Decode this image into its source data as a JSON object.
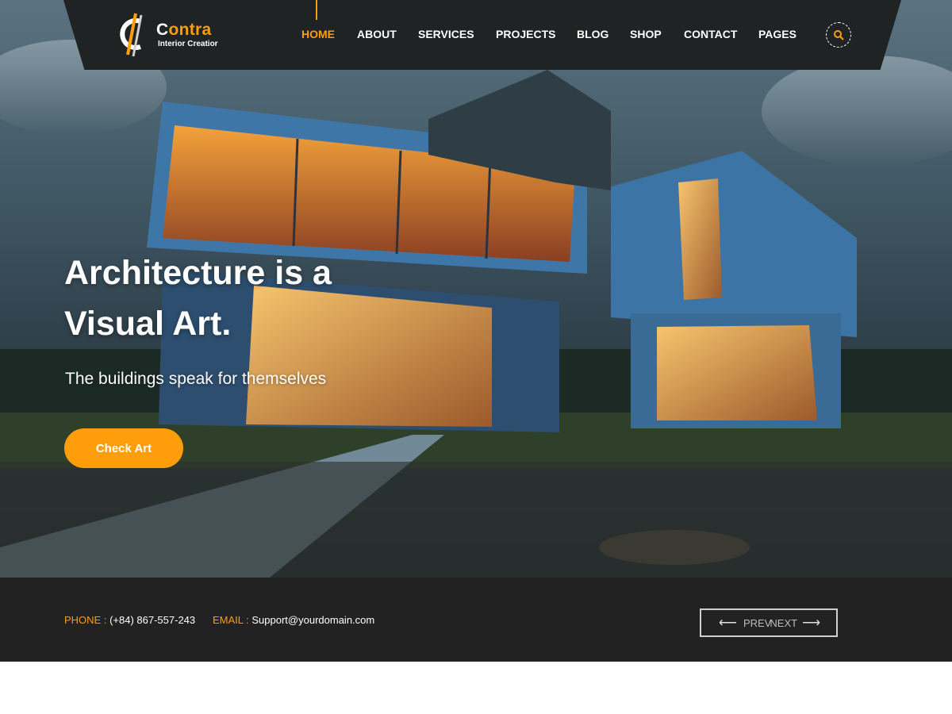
{
  "brand": {
    "name_first": "C",
    "name_rest": "ontra",
    "tagline": "Interior Creatior",
    "accent": "#ff9d0b"
  },
  "nav": {
    "items": [
      {
        "label": "HOME",
        "active": true
      },
      {
        "label": "ABOUT",
        "active": false
      },
      {
        "label": "SERVICES",
        "active": false
      },
      {
        "label": "PROJECTS",
        "active": false
      },
      {
        "label": "BLOG",
        "active": false
      },
      {
        "label": "SHOP",
        "active": false
      },
      {
        "label": "CONTACT",
        "active": false
      },
      {
        "label": "PAGES",
        "active": false
      }
    ],
    "search_icon": "search-icon"
  },
  "hero": {
    "title_line1": "Architecture is a",
    "title_line2": "Visual Art.",
    "subtitle": "The buildings speak for themselves",
    "cta_label": "Check Art"
  },
  "footer": {
    "phone_label": "PHONE :",
    "phone_value": "(+84) 867-557-243",
    "email_label": "EMAIL :",
    "email_value": "Support@yourdomain.com",
    "prev_label": "PREV",
    "next_label": "NEXT"
  }
}
